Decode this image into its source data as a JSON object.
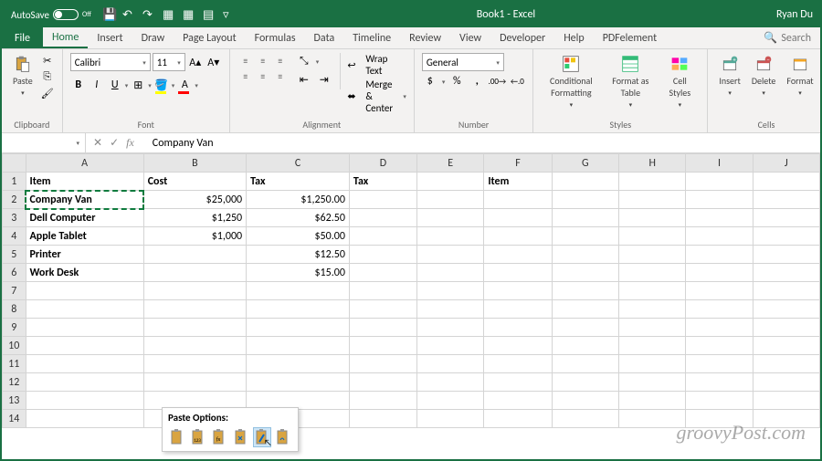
{
  "titlebar": {
    "autosave_label": "AutoSave",
    "autosave_state": "Off",
    "title": "Book1 - Excel",
    "user": "Ryan Du"
  },
  "menu": {
    "file": "File",
    "home": "Home",
    "insert": "Insert",
    "draw": "Draw",
    "page_layout": "Page Layout",
    "formulas": "Formulas",
    "data": "Data",
    "timeline": "Timeline",
    "review": "Review",
    "view": "View",
    "developer": "Developer",
    "help": "Help",
    "pdfelement": "PDFelement",
    "search": "Search"
  },
  "ribbon": {
    "clipboard": {
      "paste": "Paste",
      "group": "Clipboard"
    },
    "font": {
      "name": "Calibri",
      "size": "11",
      "group": "Font"
    },
    "alignment": {
      "wrap": "Wrap Text",
      "merge": "Merge & Center",
      "group": "Alignment"
    },
    "number": {
      "format": "General",
      "group": "Number"
    },
    "styles": {
      "cond": "Conditional Formatting",
      "fmt_table": "Format as Table",
      "cell_styles": "Cell Styles",
      "group": "Styles"
    },
    "cells": {
      "insert": "Insert",
      "delete": "Delete",
      "format": "Format",
      "group": "Cells"
    }
  },
  "formula_bar": {
    "name_box": "",
    "value": "Company Van"
  },
  "columns": [
    "A",
    "B",
    "C",
    "D",
    "E",
    "F",
    "G",
    "H",
    "I",
    "J"
  ],
  "rows": [
    "1",
    "2",
    "3",
    "4",
    "5",
    "6",
    "7",
    "8",
    "9",
    "10",
    "11",
    "12",
    "13",
    "14"
  ],
  "cells": {
    "A1": "Item",
    "B1": "Cost",
    "C1": "Tax",
    "D1": "Tax",
    "F1": "Item",
    "A2": "Company Van",
    "B2": "$25,000",
    "C2": "$1,250.00",
    "A3": "Dell Computer",
    "B3": "$1,250",
    "C3": "$62.50",
    "A4": "Apple Tablet",
    "B4": "$1,000",
    "C4": "$50.00",
    "A5": "Printer",
    "C5": "$12.50",
    "A6": "Work Desk",
    "C6": "$15.00"
  },
  "paste_popup": {
    "title": "Paste Options:"
  },
  "watermark": "groovyPost.com"
}
